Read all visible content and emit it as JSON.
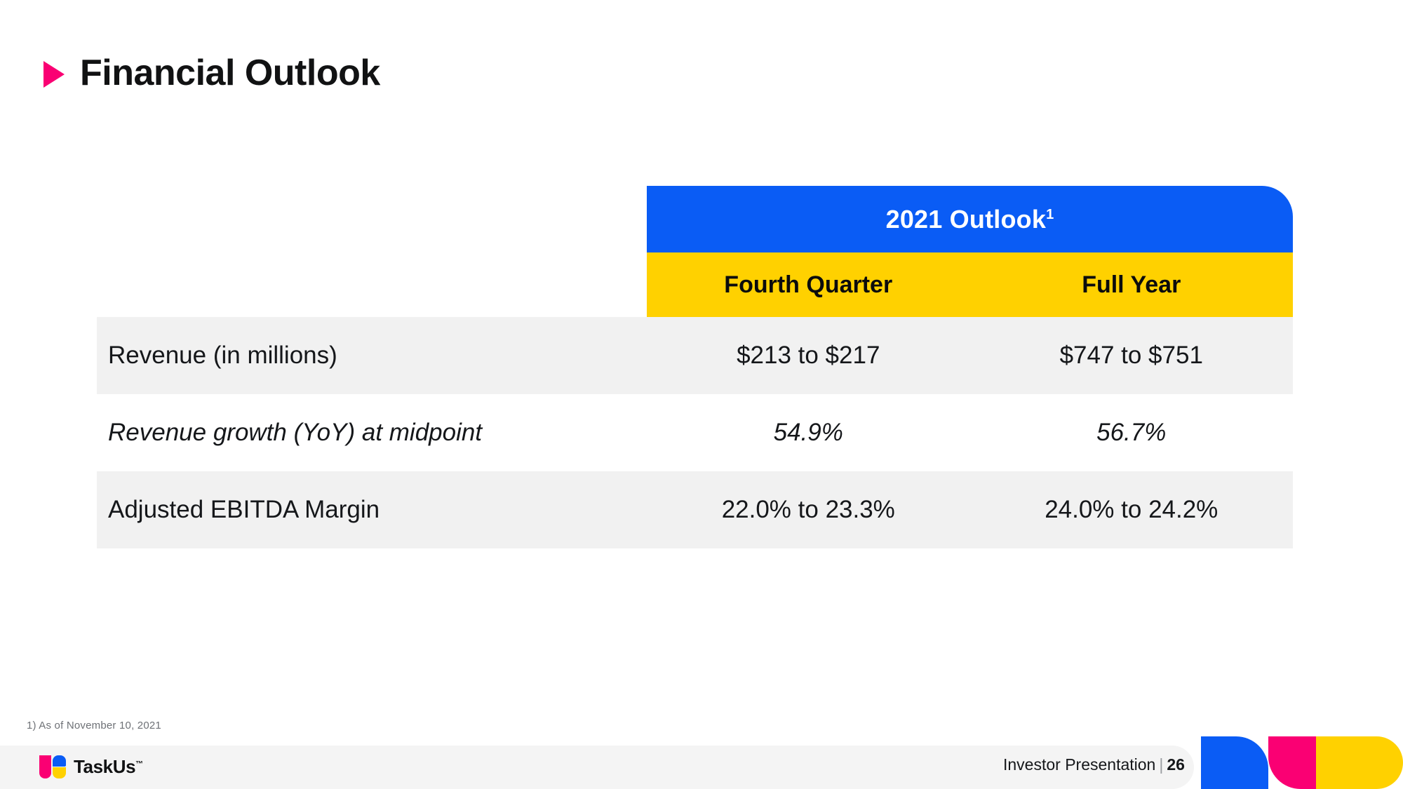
{
  "slide": {
    "title": "Financial Outlook",
    "bullet_icon": "triangle-right-icon",
    "accent_pink": "#FA0073",
    "accent_blue": "#0A5CF5",
    "accent_yellow": "#FFD100",
    "row_shade": "#F1F1F1"
  },
  "table": {
    "group_header": "2021 Outlook",
    "group_header_superscript": "1",
    "columns": [
      "Fourth Quarter",
      "Full Year"
    ],
    "rows": [
      {
        "label": "Revenue (in millions)",
        "fourth_quarter": "$213 to $217",
        "full_year": "$747 to $751",
        "style": "regular"
      },
      {
        "label": "Revenue growth (YoY) at midpoint",
        "fourth_quarter": "54.9%",
        "full_year": "56.7%",
        "style": "italic"
      },
      {
        "label": "Adjusted EBITDA Margin",
        "fourth_quarter": "22.0% to 23.3%",
        "full_year": "24.0% to 24.2%",
        "style": "regular"
      }
    ]
  },
  "footnote": "1) As of November 10, 2021",
  "footer": {
    "logo_text": "TaskUs",
    "logo_tm": "™",
    "deck_name": "Investor Presentation",
    "separator": "|",
    "page_number": "26"
  }
}
